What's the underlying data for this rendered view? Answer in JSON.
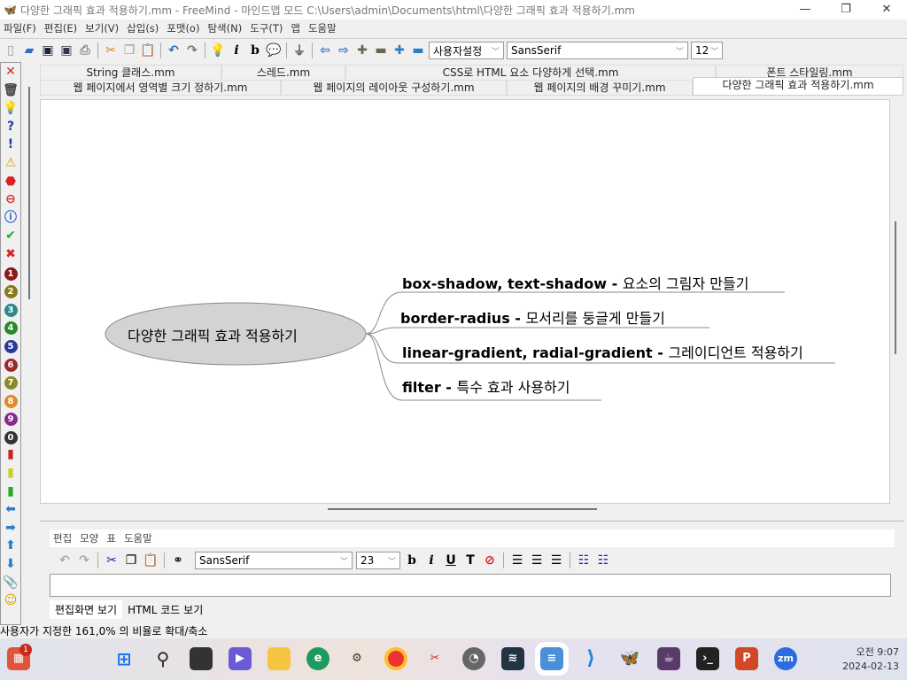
{
  "window": {
    "title": "다양한 그래픽 효과 적용하기.mm - FreeMind - 마인드맵 모드 C:\\Users\\admin\\Documents\\html\\다양한 그래픽 효과 적용하기.mm",
    "minimize": "—",
    "restore": "❐",
    "close": "✕"
  },
  "menu": [
    "파일(F)",
    "편집(E)",
    "보기(V)",
    "삽입(s)",
    "포맷(o)",
    "탐색(N)",
    "도구(T)",
    "맵",
    "도움말"
  ],
  "toolbar": {
    "style_select": "사용자설정",
    "font_select": "SansSerif",
    "size_select": "12"
  },
  "left_icons": [
    "close-x",
    "trash",
    "bulb",
    "question",
    "exclamation",
    "warning",
    "stop",
    "minus-circle",
    "info",
    "check",
    "cross",
    "1",
    "2",
    "3",
    "4",
    "5",
    "6",
    "7",
    "8",
    "9",
    "0",
    "traffic-red",
    "traffic-yellow",
    "traffic-green",
    "arrow-left",
    "arrow-right",
    "arrow-up",
    "arrow-down",
    "paperclip",
    "smiley"
  ],
  "tabs_row1": [
    "String 클래스.mm",
    "스레드.mm",
    "CSS로 HTML 요소 다양하게 선택.mm",
    "폰트 스타일링.mm"
  ],
  "tabs_row2": [
    "웹 페이지에서 영역별 크기 정하기.mm",
    "웹 페이지의 레이아웃 구성하기.mm",
    "웹 페이지의 배경 꾸미기.mm",
    "다양한 그래픽 효과 적용하기.mm"
  ],
  "mindmap": {
    "root": "다양한 그래픽 효과 적용하기",
    "children": [
      {
        "keyword": "box-shadow, text-shadow - ",
        "desc": "요소의 그림자 만들기"
      },
      {
        "keyword": "border-radius - ",
        "desc": "모서리를 둥글게 만들기"
      },
      {
        "keyword": "linear-gradient, radial-gradient - ",
        "desc": "그레이디언트 적용하기"
      },
      {
        "keyword": "filter - ",
        "desc": "특수 효과 사용하기"
      }
    ]
  },
  "note": {
    "menu": [
      "편집",
      "모양",
      "표",
      "도움말"
    ],
    "font": "SansSerif",
    "size": "23",
    "tabs": [
      "편집화면 보기",
      "HTML 코드 보기"
    ]
  },
  "status": "사용자가 지정한 161,0% 의 비율로 확대/축소",
  "taskbar": {
    "badge": "1",
    "time": "오전 9:07",
    "date": "2024-02-13"
  }
}
